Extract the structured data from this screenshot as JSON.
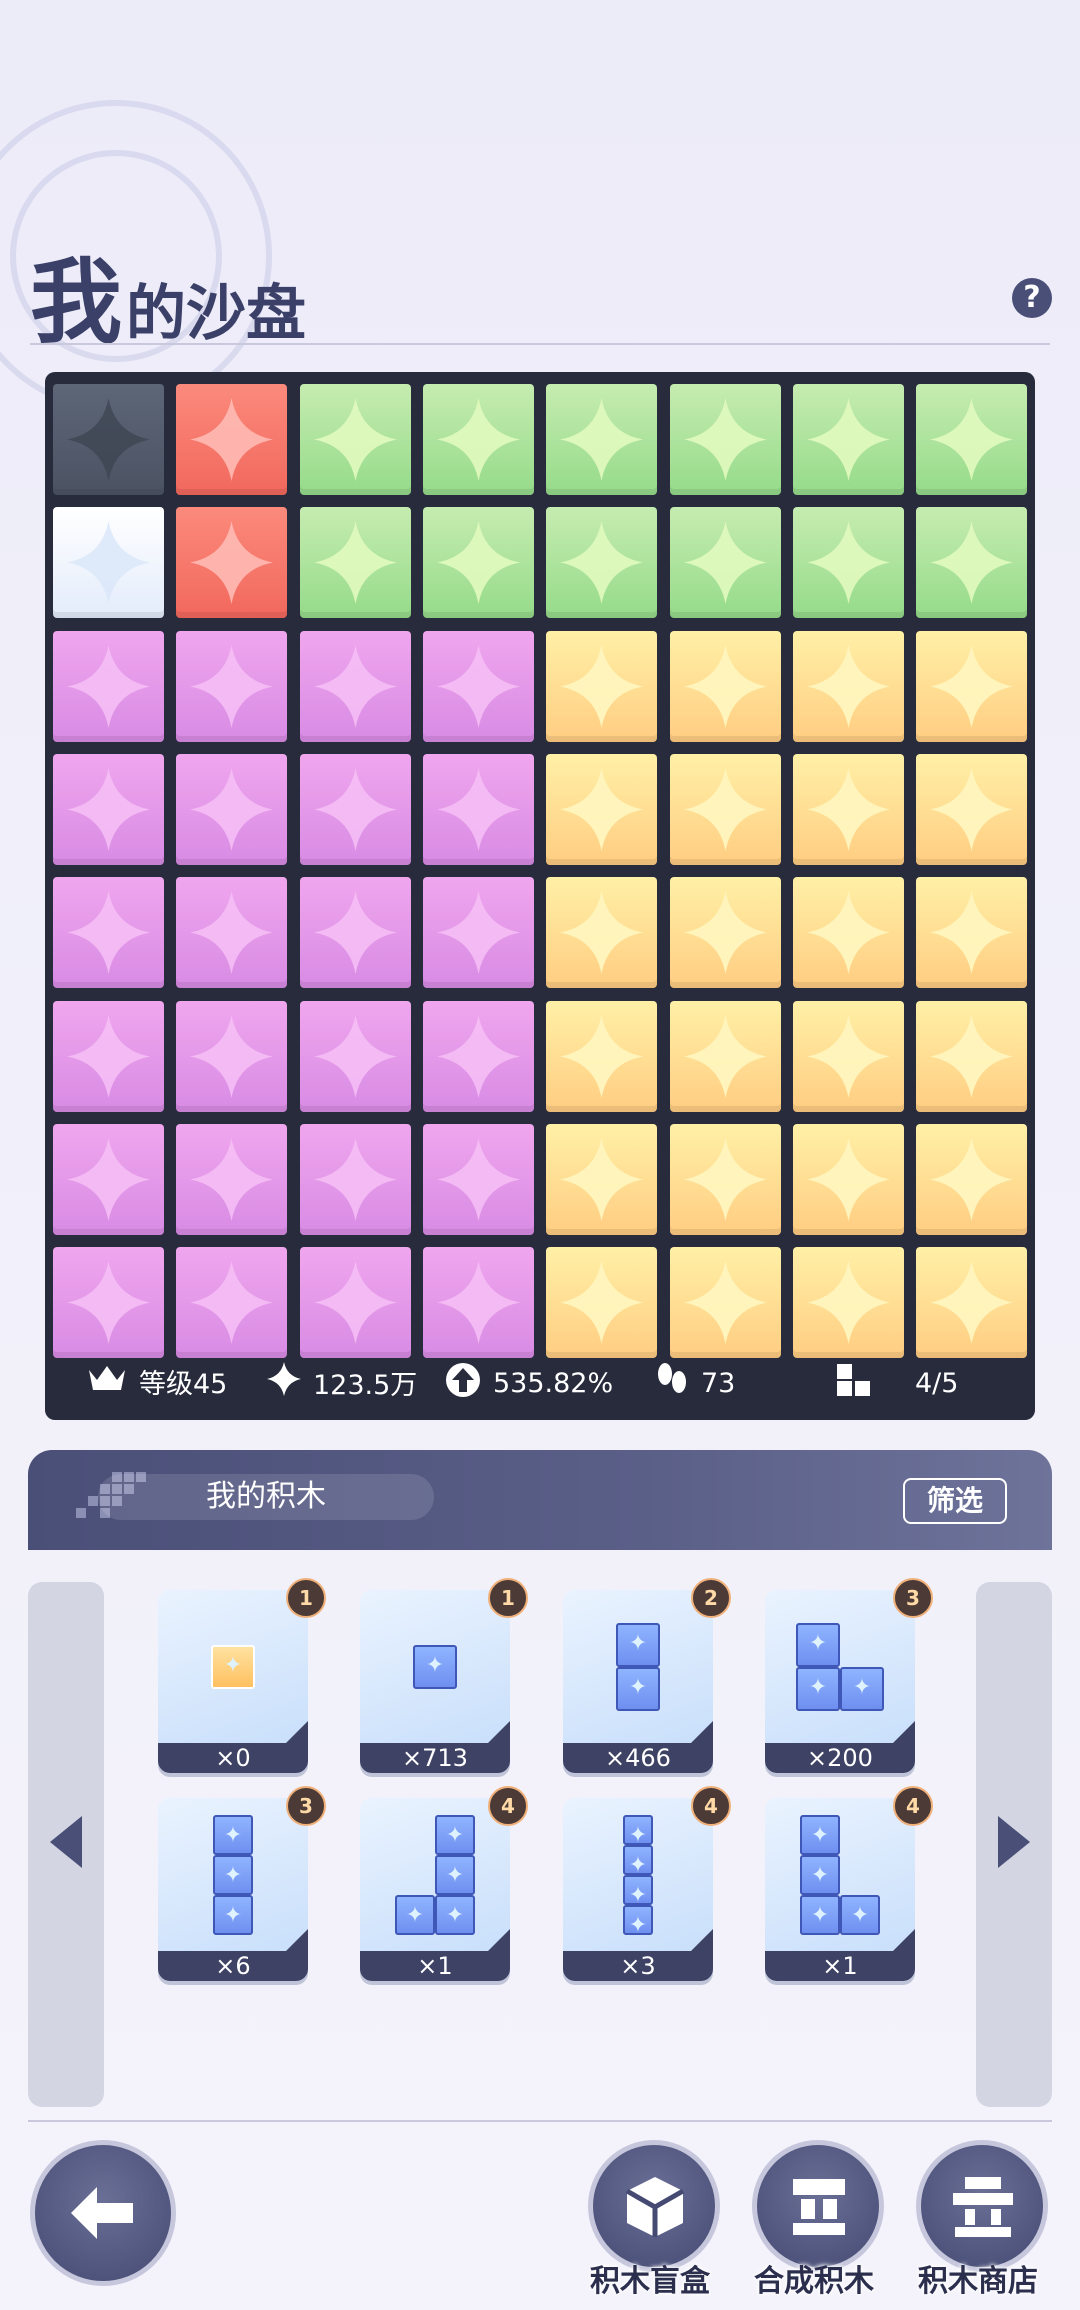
{
  "title": {
    "big": "我",
    "rest": "的沙盘"
  },
  "help": {
    "symbol": "?"
  },
  "board": {
    "rows": [
      [
        "gray",
        "red",
        "green",
        "green",
        "green",
        "green",
        "green",
        "green"
      ],
      [
        "white",
        "red",
        "green",
        "green",
        "green",
        "green",
        "green",
        "green"
      ],
      [
        "purple",
        "purple",
        "purple",
        "purple",
        "yellow",
        "yellow",
        "yellow",
        "yellow"
      ],
      [
        "purple",
        "purple",
        "purple",
        "purple",
        "yellow",
        "yellow",
        "yellow",
        "yellow"
      ],
      [
        "purple",
        "purple",
        "purple",
        "purple",
        "yellow",
        "yellow",
        "yellow",
        "yellow"
      ],
      [
        "purple",
        "purple",
        "purple",
        "purple",
        "yellow",
        "yellow",
        "yellow",
        "yellow"
      ],
      [
        "purple",
        "purple",
        "purple",
        "purple",
        "yellow",
        "yellow",
        "yellow",
        "yellow"
      ],
      [
        "purple",
        "purple",
        "purple",
        "purple",
        "yellow",
        "yellow",
        "yellow",
        "yellow"
      ]
    ]
  },
  "stats": {
    "level": "等级45",
    "sparkle": "123.5万",
    "rate": "535.82%",
    "steps": "73",
    "blocks": "4/5"
  },
  "panel": {
    "title": "我的积木",
    "filter": "筛选"
  },
  "cards": [
    {
      "badge": "1",
      "count": "×0",
      "shape": "orange-single"
    },
    {
      "badge": "1",
      "count": "×713",
      "shape": "single"
    },
    {
      "badge": "2",
      "count": "×466",
      "shape": "vertical-2"
    },
    {
      "badge": "3",
      "count": "×200",
      "shape": "L-3"
    },
    {
      "badge": "3",
      "count": "×6",
      "shape": "vertical-3"
    },
    {
      "badge": "4",
      "count": "×1",
      "shape": "J-4"
    },
    {
      "badge": "4",
      "count": "×3",
      "shape": "vertical-4"
    },
    {
      "badge": "4",
      "count": "×1",
      "shape": "L-4"
    }
  ],
  "buttons": {
    "blind_box": "积木盲盒",
    "synthesize": "合成积木",
    "shop": "积木商店"
  }
}
